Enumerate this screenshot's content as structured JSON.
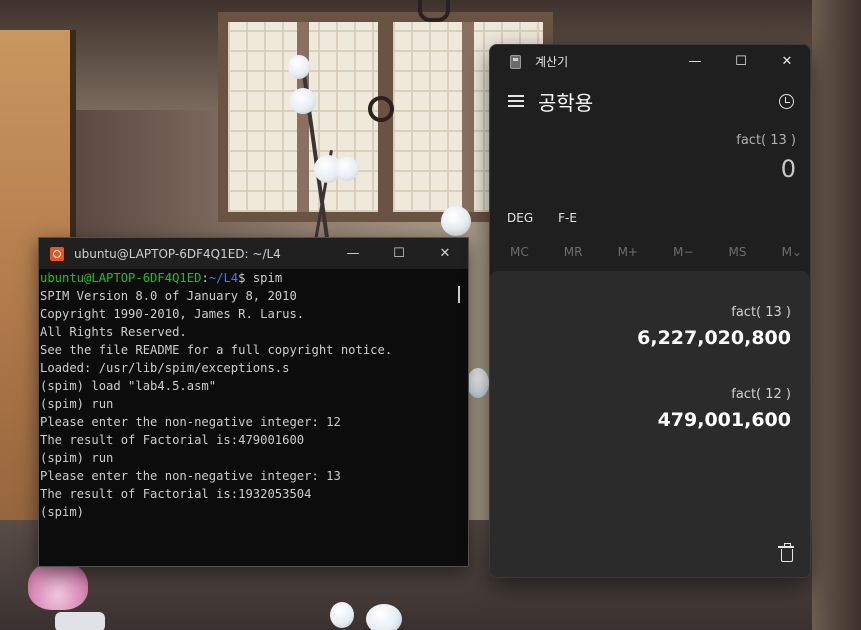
{
  "terminal": {
    "title": "ubuntu@LAPTOP-6DF4Q1ED: ~/L4",
    "controls": {
      "minimize": "—",
      "maximize": "☐",
      "close": "✕"
    },
    "prompt": {
      "user_host": "ubuntu@LAPTOP-6DF4Q1ED",
      "separator": ":",
      "path": "~/L4",
      "suffix": "$ ",
      "command": "spim"
    },
    "lines": [
      "SPIM Version 8.0 of January 8, 2010",
      "Copyright 1990-2010, James R. Larus.",
      "All Rights Reserved.",
      "See the file README for a full copyright notice.",
      "Loaded: /usr/lib/spim/exceptions.s",
      "(spim) load \"lab4.5.asm\"",
      "(spim) run",
      "Please enter the non-negative integer: 12",
      "The result of Factorial is:479001600",
      "(spim) run",
      "Please enter the non-negative integer: 13",
      "The result of Factorial is:1932053504",
      "(spim)"
    ]
  },
  "calculator": {
    "title": "계산기",
    "controls": {
      "minimize": "—",
      "maximize": "☐",
      "close": "✕"
    },
    "mode": "공학용",
    "expression": "fact( 13 )",
    "display": "0",
    "angle_mode": "DEG",
    "notation": "F-E",
    "memory_buttons": [
      "MC",
      "MR",
      "M+",
      "M−",
      "MS",
      "M⌄"
    ],
    "history": [
      {
        "expression": "fact( 13 )",
        "result": "6,227,020,800"
      },
      {
        "expression": "fact( 12 )",
        "result": "479,001,600"
      }
    ]
  }
}
